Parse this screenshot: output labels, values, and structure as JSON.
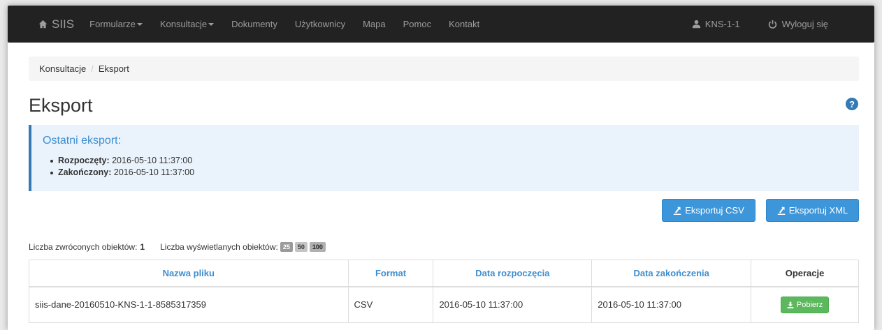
{
  "navbar": {
    "brand": "SIIS",
    "items": [
      {
        "label": "Formularze",
        "dropdown": true
      },
      {
        "label": "Konsultacje",
        "dropdown": true
      },
      {
        "label": "Dokumenty"
      },
      {
        "label": "Użytkownicy"
      },
      {
        "label": "Mapa"
      },
      {
        "label": "Pomoc"
      },
      {
        "label": "Kontakt"
      }
    ],
    "user": "KNS-1-1",
    "logout": "Wyloguj się"
  },
  "breadcrumb": {
    "parent": "Konsultacje",
    "current": "Eksport"
  },
  "page_title": "Eksport",
  "last_export": {
    "heading": "Ostatni eksport:",
    "started_label": "Rozpoczęty:",
    "started_value": "2016-05-10 11:37:00",
    "finished_label": "Zakończony:",
    "finished_value": "2016-05-10 11:37:00"
  },
  "actions": {
    "csv": "Eksportuj CSV",
    "xml": "Eksportuj XML"
  },
  "counts": {
    "returned_label": "Liczba zwróconych obiektów:",
    "returned_value": "1",
    "displayed_label": "Liczba wyświetlanych obiektów:",
    "page_sizes": [
      "25",
      "50",
      "100"
    ]
  },
  "table": {
    "headers": [
      "Nazwa pliku",
      "Format",
      "Data rozpoczęcia",
      "Data zakończenia",
      "Operacje"
    ],
    "rows": [
      {
        "file": "siis-dane-20160510-KNS-1-1-8585317359",
        "format": "CSV",
        "start": "2016-05-10 11:37:00",
        "end": "2016-05-10 11:37:00",
        "action": "Pobierz"
      }
    ]
  },
  "colors": {
    "navbar": "#222222",
    "primary": "#3c96d9",
    "success": "#5cb85c",
    "callout": "#eaf3fb"
  }
}
